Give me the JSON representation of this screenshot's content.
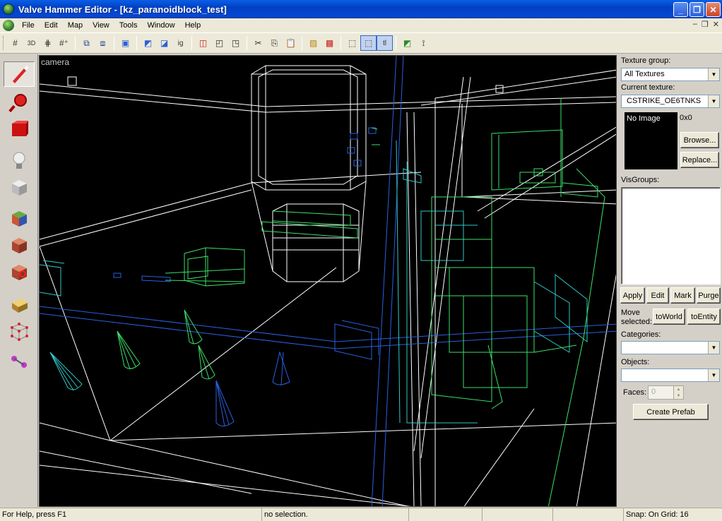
{
  "window": {
    "title": "Valve Hammer Editor - [kz_paranoidblock_test]"
  },
  "menu": {
    "items": [
      "File",
      "Edit",
      "Map",
      "View",
      "Tools",
      "Window",
      "Help"
    ]
  },
  "toolbar": {
    "buttons": [
      "grid-icon",
      "3d-grid-icon",
      "grid-dots-icon",
      "grid-add-icon",
      "group-icon",
      "ungroup-icon",
      "visgroups-icon",
      "carve-icon",
      "hollow-icon",
      "ignore-groups-icon",
      "cut-icon",
      "copy-icon",
      "paste-icon",
      "texture-lock-icon",
      "entity-icon",
      "select-icon",
      "toggle-icon",
      "run-map-icon",
      "paint-icon"
    ]
  },
  "viewport": {
    "label": "camera"
  },
  "right_panel": {
    "texture_group_label": "Texture group:",
    "texture_group_value": "All Textures",
    "current_texture_label": "Current texture:",
    "current_texture_value": "CSTRIKE_OE6TNKS",
    "preview_text": "No Image",
    "dims": "0x0",
    "browse": "Browse...",
    "replace": "Replace...",
    "visgroups_label": "VisGroups:",
    "apply": "Apply",
    "edit": "Edit",
    "mark": "Mark",
    "purge": "Purge",
    "move_selected_label_1": "Move",
    "move_selected_label_2": "selected:",
    "to_world": "toWorld",
    "to_entity": "toEntity",
    "categories_label": "Categories:",
    "objects_label": "Objects:",
    "faces_label": "Faces:",
    "faces_value": "0",
    "create_prefab": "Create Prefab"
  },
  "status": {
    "help": "For Help, press F1",
    "selection": "no selection.",
    "snap": "Snap: On Grid: 16"
  },
  "colors": {
    "titlebar": "#0447d4",
    "viewport_bg": "#000000",
    "wire_white": "#ffffff",
    "wire_blue": "#2a5fe0",
    "wire_cyan": "#30c8c8",
    "wire_green": "#3ce06a"
  }
}
